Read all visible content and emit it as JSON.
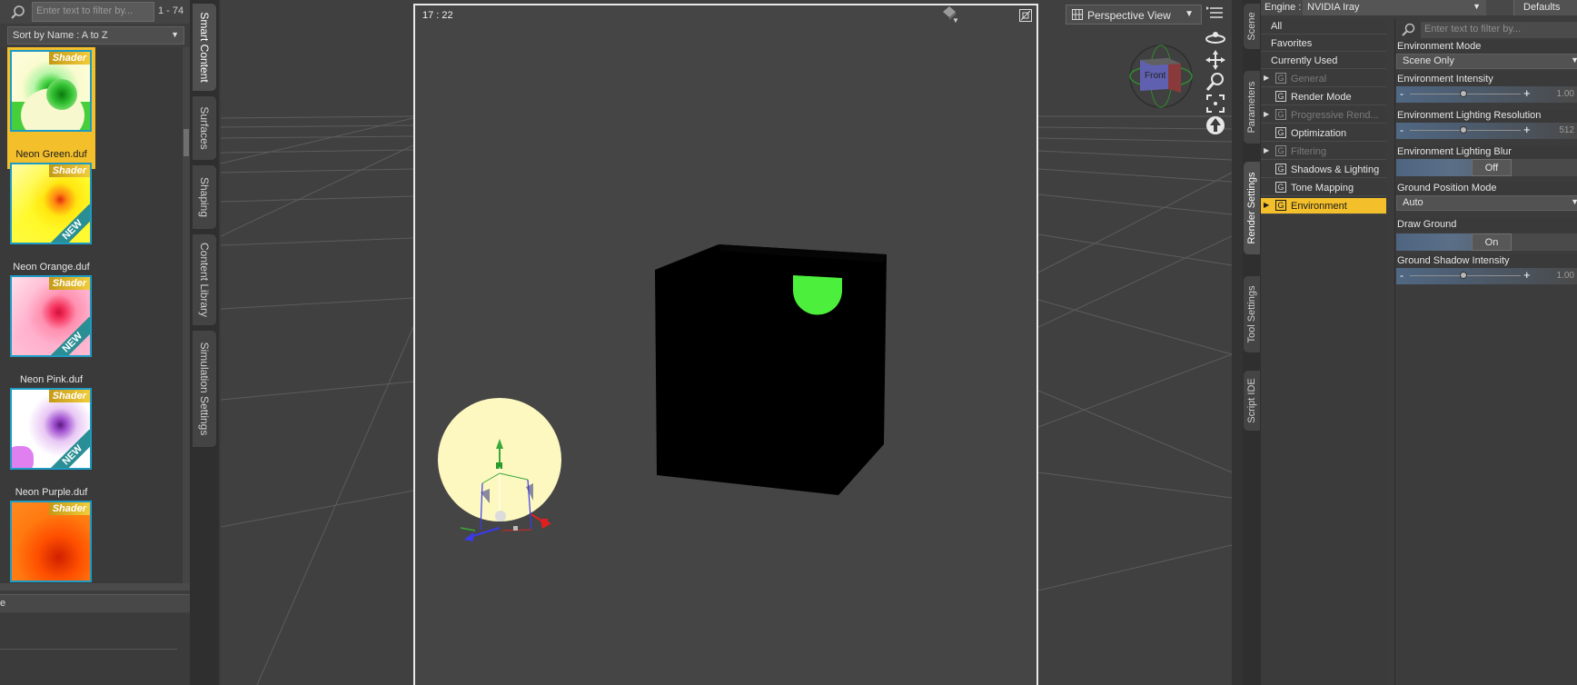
{
  "content_library": {
    "filter_placeholder": "Enter text to filter by...",
    "count": "1 - 74",
    "sort_label": "Sort by Name : A to Z",
    "items": [
      {
        "label": "Neon Green.duf",
        "tag": "Shader",
        "new_tag": "",
        "selected": true
      },
      {
        "label": "Neon Orange.duf",
        "tag": "Shader",
        "new_tag": "NEW",
        "selected": false
      },
      {
        "label": "Neon Pink.duf",
        "tag": "Shader",
        "new_tag": "NEW",
        "selected": false
      },
      {
        "label": "Neon Purple.duf",
        "tag": "Shader",
        "new_tag": "NEW",
        "selected": false
      },
      {
        "label": "",
        "tag": "Shader",
        "new_tag": "",
        "selected": false
      }
    ],
    "bottom_tab_label": "e"
  },
  "left_tabs": [
    "Smart Content",
    "Surfaces",
    "Shaping",
    "Content Library",
    "Simulation Settings"
  ],
  "viewport": {
    "timecode": "17 : 22",
    "view_label": "Perspective View",
    "nav_cube_label": "Front"
  },
  "right_tabs": [
    "Scene",
    "Parameters",
    "Render Settings",
    "Tool Settings",
    "Script IDE"
  ],
  "render_settings": {
    "engine_label": "Engine :",
    "engine_value": "NVIDIA Iray",
    "defaults_label": "Defaults",
    "top_items": [
      "All",
      "Favorites",
      "Currently Used"
    ],
    "groups": [
      {
        "label": "General",
        "disabled": true,
        "arrow": true,
        "active": false
      },
      {
        "label": "Render Mode",
        "disabled": false,
        "arrow": false,
        "active": false
      },
      {
        "label": "Progressive Rend...",
        "disabled": true,
        "arrow": true,
        "active": false
      },
      {
        "label": "Optimization",
        "disabled": false,
        "arrow": false,
        "active": false
      },
      {
        "label": "Filtering",
        "disabled": true,
        "arrow": true,
        "active": false
      },
      {
        "label": "Shadows & Lighting",
        "disabled": false,
        "arrow": false,
        "active": false
      },
      {
        "label": "Tone Mapping",
        "disabled": false,
        "arrow": false,
        "active": false
      },
      {
        "label": "Environment",
        "disabled": false,
        "arrow": true,
        "active": true
      }
    ],
    "prop_filter_placeholder": "Enter text to filter by...",
    "properties": {
      "env_mode": {
        "label": "Environment Mode",
        "value": "Scene Only"
      },
      "env_intensity": {
        "label": "Environment Intensity",
        "value": "1.00"
      },
      "env_lighting_res": {
        "label": "Environment Lighting Resolution",
        "value": "512"
      },
      "env_lighting_blur": {
        "label": "Environment Lighting Blur",
        "value": "Off"
      },
      "ground_pos_mode": {
        "label": "Ground Position Mode",
        "value": "Auto"
      },
      "draw_ground": {
        "label": "Draw Ground",
        "value": "On"
      },
      "ground_shadow_intensity": {
        "label": "Ground Shadow Intensity",
        "value": "1.00"
      }
    }
  },
  "colors": {
    "accent": "#f3bf2b",
    "viewport_bg": "#404040",
    "cube": "#000000",
    "cube_highlight": "#4cf03c",
    "sphere": "#fcf8c0"
  },
  "icons": {
    "search": "search-icon",
    "grid": "grid-icon",
    "orbit": "orbit-icon",
    "pan": "pan-icon",
    "zoom": "zoom-icon",
    "frame": "frame-icon",
    "up": "up-icon"
  }
}
